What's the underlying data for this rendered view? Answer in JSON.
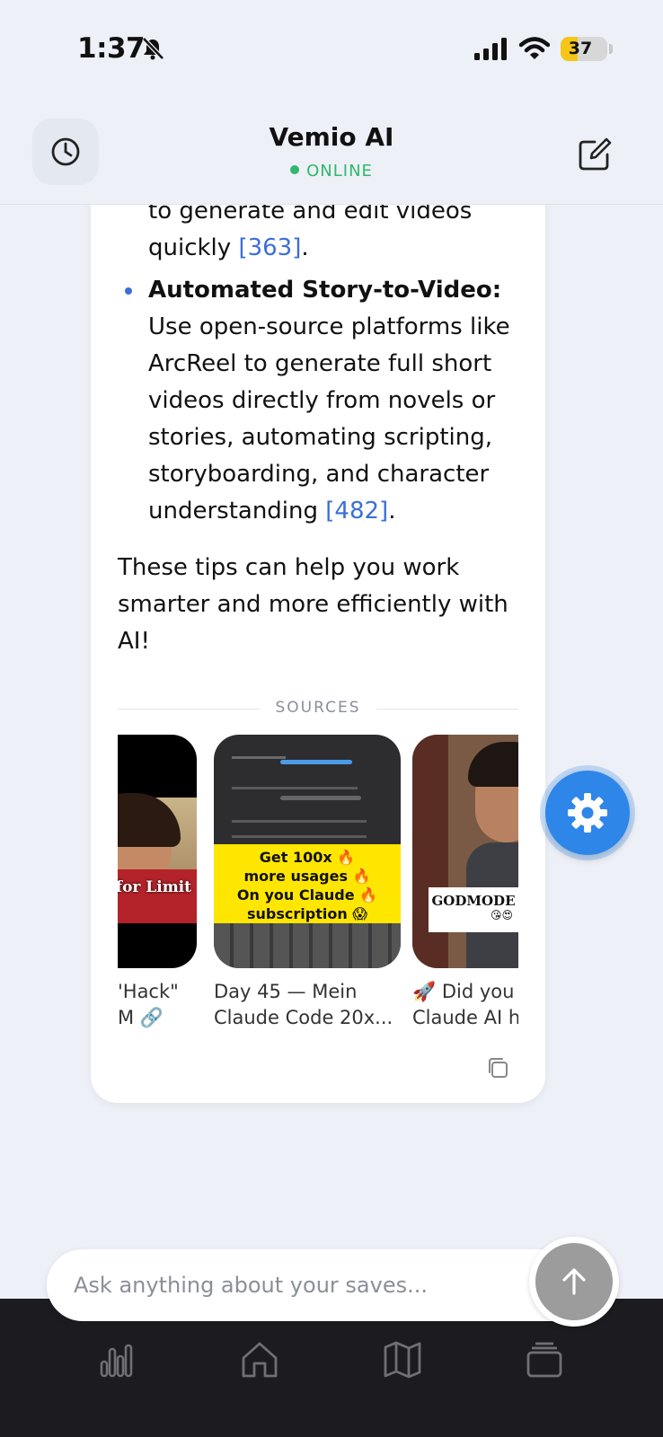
{
  "status_bar": {
    "time": "1:37",
    "battery": "37",
    "battery_level": 0.37
  },
  "header": {
    "title": "Vemio AI",
    "status": "ONLINE"
  },
  "message": {
    "fragment_line1": "to generate and edit videos",
    "fragment_line2": "quickly",
    "fragment_cite": "[363]",
    "bullet_title": "Automated Story-to-Video:",
    "bullet_body": "Use open-source platforms like ArcReel to generate full short videos directly from novels or stories, automating scripting, storyboarding, and character understanding",
    "bullet_cite": "[482]",
    "closing": "These tips can help you work smarter and more efficiently with AI!"
  },
  "sources": {
    "label": "SOURCES",
    "items": [
      {
        "title_line1": "'Hack\"",
        "title_line2": "M 🔗",
        "overlay": "for Limit"
      },
      {
        "title_line1": "Day 45 — Mein",
        "title_line2": "Claude Code 20x...",
        "overlay_lines": [
          "Get 100x 🔥",
          "more usages 🔥",
          "On you Claude 🔥",
          "subscription 😱"
        ]
      },
      {
        "title_line1": "🚀 Did you",
        "title_line2": "Claude AI h",
        "overlay": "GODMODE",
        "overlay_emoji": "😘😍"
      }
    ]
  },
  "input": {
    "placeholder": "Ask anything about your saves..."
  },
  "colors": {
    "accent": "#3a6fd8",
    "online": "#2fb86b",
    "gear": "#2e86e8",
    "nav": "#1c1c20"
  }
}
